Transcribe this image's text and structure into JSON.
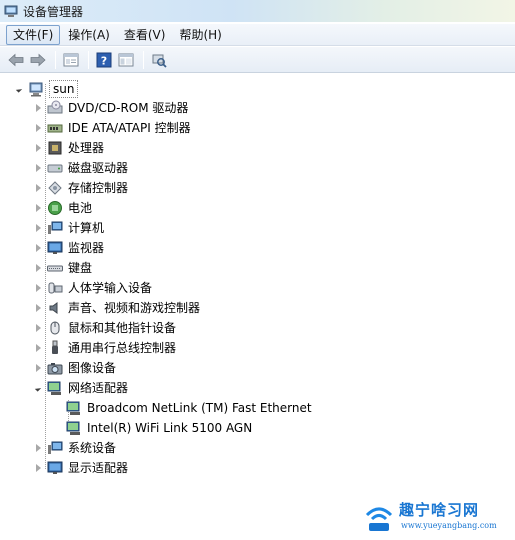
{
  "window": {
    "title": "设备管理器"
  },
  "menu": [
    "文件(F)",
    "操作(A)",
    "查看(V)",
    "帮助(H)"
  ],
  "toolbar": [
    "back-arrow-icon",
    "forward-arrow-icon",
    "properties-icon",
    "help-icon",
    "console-tree-icon",
    "scan-hardware-icon"
  ],
  "tree": {
    "root": "sun",
    "categories": [
      "DVD/CD-ROM 驱动器",
      "IDE ATA/ATAPI 控制器",
      "处理器",
      "磁盘驱动器",
      "存储控制器",
      "电池",
      "计算机",
      "监视器",
      "键盘",
      "人体学输入设备",
      "声音、视频和游戏控制器",
      "鼠标和其他指针设备",
      "通用串行总线控制器",
      "图像设备",
      "网络适配器",
      "系统设备",
      "显示适配器"
    ],
    "network_children": [
      "Broadcom NetLink (TM) Fast Ethernet",
      "Intel(R) WiFi Link 5100 AGN"
    ]
  },
  "watermark": {
    "text": "趣宁啥习网",
    "url": "www.yueyangbang.com"
  }
}
